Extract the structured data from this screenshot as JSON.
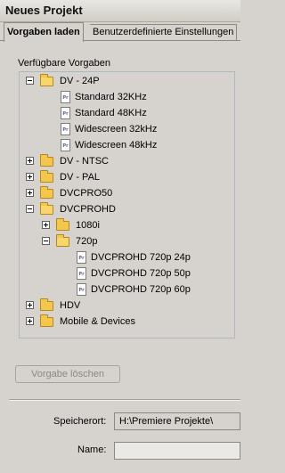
{
  "window": {
    "title": "Neues Projekt"
  },
  "tabs": [
    {
      "label": "Vorgaben laden"
    },
    {
      "label": "Benutzerdefinierte Einstellungen"
    }
  ],
  "presets": {
    "group_label": "Verfügbare Vorgaben",
    "file_icon_label": "Pr",
    "tree": [
      {
        "label": "DV - 24P",
        "type": "folder",
        "expanded": true,
        "depth": 0
      },
      {
        "label": "Standard 32KHz",
        "type": "file",
        "depth": 1
      },
      {
        "label": "Standard 48KHz",
        "type": "file",
        "depth": 1
      },
      {
        "label": "Widescreen 32kHz",
        "type": "file",
        "depth": 1
      },
      {
        "label": "Widescreen 48kHz",
        "type": "file",
        "depth": 1
      },
      {
        "label": "DV - NTSC",
        "type": "folder",
        "expanded": false,
        "depth": 0
      },
      {
        "label": "DV - PAL",
        "type": "folder",
        "expanded": false,
        "depth": 0
      },
      {
        "label": "DVCPRO50",
        "type": "folder",
        "expanded": false,
        "depth": 0
      },
      {
        "label": "DVCPROHD",
        "type": "folder",
        "expanded": true,
        "depth": 0
      },
      {
        "label": "1080i",
        "type": "folder",
        "expanded": false,
        "depth": 1
      },
      {
        "label": "720p",
        "type": "folder",
        "expanded": true,
        "depth": 1
      },
      {
        "label": "DVCPROHD 720p 24p",
        "type": "file",
        "depth": 2
      },
      {
        "label": "DVCPROHD 720p 50p",
        "type": "file",
        "depth": 2
      },
      {
        "label": "DVCPROHD 720p 60p",
        "type": "file",
        "depth": 2
      },
      {
        "label": "HDV",
        "type": "folder",
        "expanded": false,
        "depth": 0
      },
      {
        "label": "Mobile & Devices",
        "type": "folder",
        "expanded": false,
        "depth": 0
      }
    ],
    "delete_button": "Vorgabe löschen"
  },
  "location": {
    "label": "Speicherort:",
    "value": "H:\\Premiere Projekte\\"
  },
  "name": {
    "label": "Name:",
    "value": ""
  }
}
